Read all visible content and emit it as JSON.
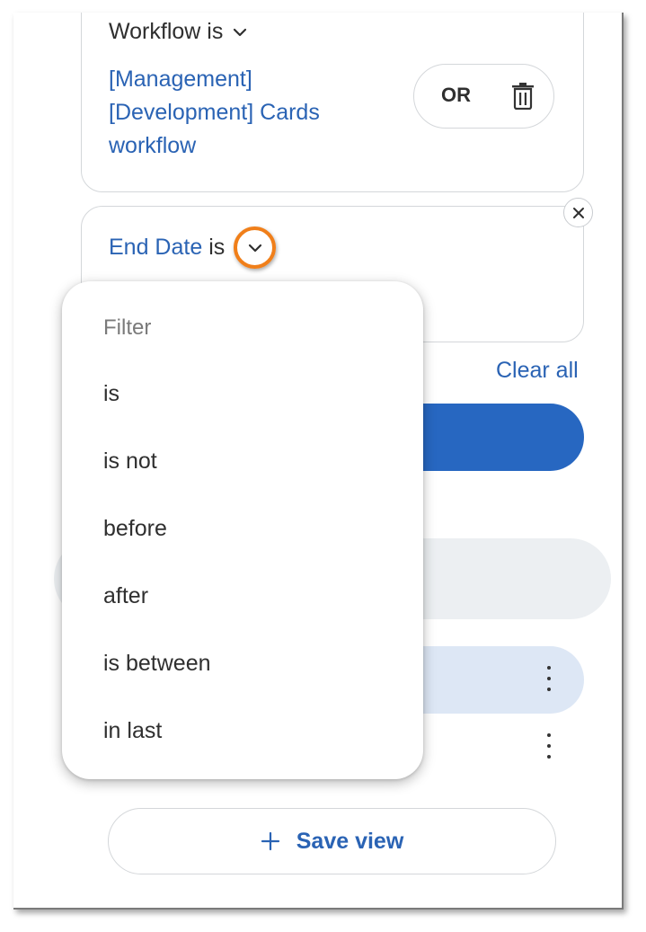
{
  "workflow_filter": {
    "heading": "Workflow is",
    "value": "[Management] [Development] Cards workflow",
    "or_label": "OR"
  },
  "end_date_filter": {
    "label": "End Date",
    "operator": "is"
  },
  "dropdown": {
    "title": "Filter",
    "items": [
      "is",
      "is not",
      "before",
      "after",
      "is between",
      "in last"
    ]
  },
  "clear_all_label": "Clear all",
  "save_view_label": "Save view",
  "colors": {
    "accent": "#2a63b4",
    "primary_button": "#2767c1",
    "highlight_ring": "#f07f1a"
  },
  "icons": {
    "chevron": "chevron-down-icon",
    "trash": "trash-icon",
    "close": "close-icon",
    "kebab": "kebab-icon",
    "plus": "plus-icon"
  }
}
